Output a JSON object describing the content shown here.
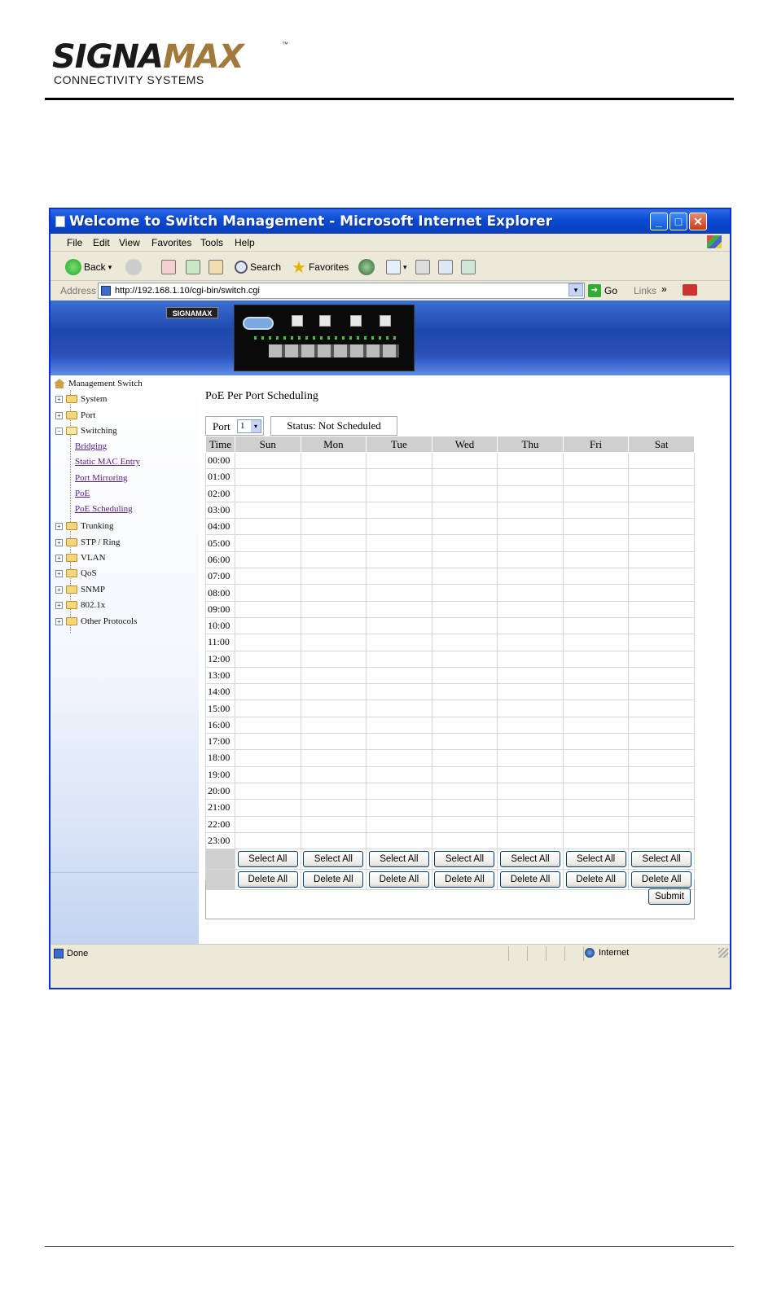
{
  "brand": {
    "logo_main": "SIGNA",
    "logo_accent": "MAX",
    "trademark": "™",
    "tagline": "CONNECTIVITY SYSTEMS"
  },
  "window": {
    "title": "Welcome to Switch Management - Microsoft Internet Explorer",
    "menu": [
      "File",
      "Edit",
      "View",
      "Favorites",
      "Tools",
      "Help"
    ],
    "toolbar": {
      "back_label": "Back",
      "search_label": "Search",
      "favorites_label": "Favorites"
    },
    "address": {
      "label": "Address",
      "url": "http://192.168.1.10/cgi-bin/switch.cgi",
      "go_label": "Go",
      "links_label": "Links"
    },
    "status": {
      "text": "Done",
      "zone": "Internet"
    }
  },
  "banner": {
    "logo_text": "SIGNAMAX"
  },
  "sidebar": {
    "root": "Management Switch",
    "folders_top": [
      "System",
      "Port",
      "Switching"
    ],
    "switching_links": [
      "Bridging",
      "Static MAC Entry",
      "Port Mirroring",
      "PoE",
      "PoE Scheduling"
    ],
    "folders_bottom": [
      "Trunking",
      "STP / Ring",
      "VLAN",
      "QoS",
      "SNMP",
      "802.1x",
      "Other Protocols"
    ]
  },
  "content": {
    "heading": "PoE Per Port Scheduling",
    "port_label": "Port",
    "port_value": "1",
    "status": "Status: Not Scheduled",
    "table": {
      "time_header": "Time",
      "days": [
        "Sun",
        "Mon",
        "Tue",
        "Wed",
        "Thu",
        "Fri",
        "Sat"
      ],
      "hours": [
        "00:00",
        "01:00",
        "02:00",
        "03:00",
        "04:00",
        "05:00",
        "06:00",
        "07:00",
        "08:00",
        "09:00",
        "10:00",
        "11:00",
        "12:00",
        "13:00",
        "14:00",
        "15:00",
        "16:00",
        "17:00",
        "18:00",
        "19:00",
        "20:00",
        "21:00",
        "22:00",
        "23:00"
      ],
      "select_all_label": "Select All",
      "delete_all_label": "Delete All"
    },
    "submit_label": "Submit"
  }
}
